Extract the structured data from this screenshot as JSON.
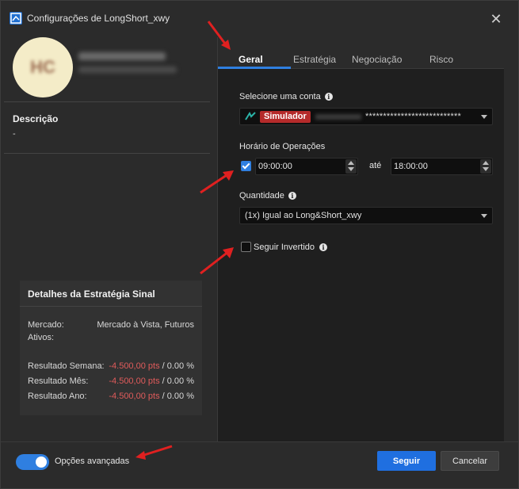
{
  "window": {
    "title": "Configurações de LongShort_xwy",
    "close_glyph": "✕"
  },
  "profile": {
    "avatar_initials": "HC"
  },
  "description": {
    "label": "Descrição",
    "value": "-"
  },
  "strategy_details": {
    "title": "Detalhes da Estratégia Sinal",
    "market_label": "Mercado:",
    "market_value": "Mercado à Vista, Futuros",
    "assets_label": "Ativos:",
    "results": [
      {
        "label": "Resultado Semana:",
        "pts": "-4.500,00 pts",
        "pct": " / 0.00 %"
      },
      {
        "label": "Resultado Mês:",
        "pts": "-4.500,00 pts",
        "pct": " / 0.00 %"
      },
      {
        "label": "Resultado Ano:",
        "pts": "-4.500,00 pts",
        "pct": " / 0.00 %"
      }
    ]
  },
  "tabs": [
    {
      "label": "Geral",
      "active": true
    },
    {
      "label": "Estratégia",
      "active": false
    },
    {
      "label": "Negociação",
      "active": false
    },
    {
      "label": "Risco",
      "active": false
    }
  ],
  "form": {
    "account": {
      "label": "Selecione uma conta",
      "badge": "Simulador",
      "masked": "***************************"
    },
    "hours": {
      "label": "Horário de Operações",
      "enabled": true,
      "start": "09:00:00",
      "separator": "até",
      "end": "18:00:00"
    },
    "quantity": {
      "label": "Quantidade",
      "value": "(1x) Igual ao Long&Short_xwy"
    },
    "follow_inverted": {
      "label": "Seguir Invertido",
      "checked": false
    }
  },
  "footer": {
    "advanced_label": "Opções avançadas",
    "advanced_enabled": true,
    "follow_button": "Seguir",
    "cancel_button": "Cancelar"
  },
  "colors": {
    "accent": "#2f7fe0",
    "negative": "#e05b5b",
    "badge": "#b52a2a",
    "annotation_arrow": "#e02020"
  }
}
